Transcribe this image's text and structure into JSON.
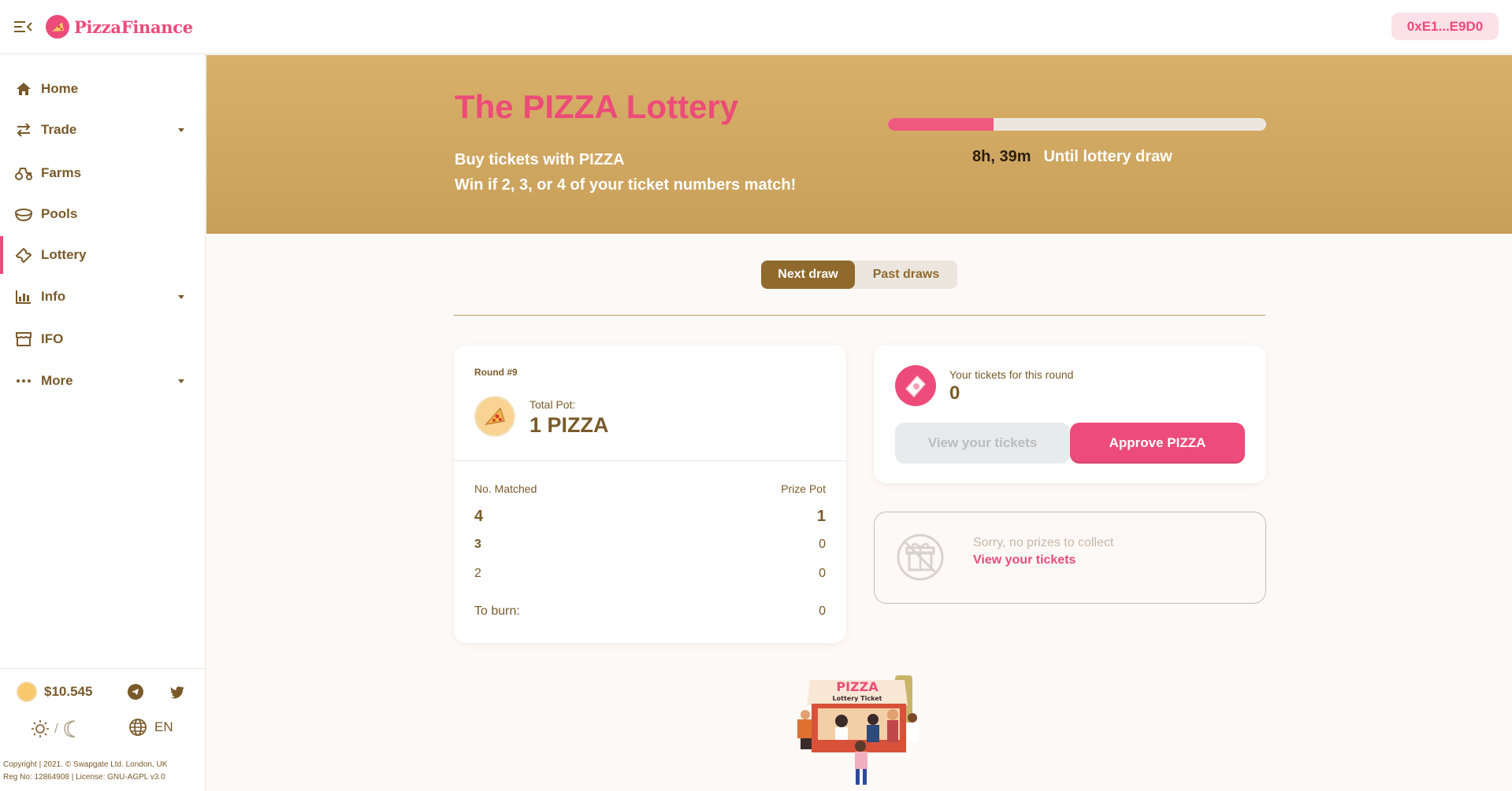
{
  "header": {
    "brand": "PizzaFinance",
    "wallet": "0xE1...E9D0"
  },
  "sidebar": {
    "items": [
      {
        "label": "Home",
        "icon": "home-icon"
      },
      {
        "label": "Trade",
        "icon": "swap-icon",
        "expandable": true
      },
      {
        "label": "Farms",
        "icon": "tractor-icon"
      },
      {
        "label": "Pools",
        "icon": "bowl-icon"
      },
      {
        "label": "Lottery",
        "icon": "ticket-icon",
        "active": true
      },
      {
        "label": "Info",
        "icon": "chart-icon",
        "expandable": true
      },
      {
        "label": "IFO",
        "icon": "store-icon"
      },
      {
        "label": "More",
        "icon": "more-icon",
        "expandable": true
      }
    ],
    "footer": {
      "price": "$10.545",
      "theme_separator": "/",
      "language": "EN",
      "copyright_line1": "Copyright | 2021. © Swapgate Ltd. London, UK",
      "copyright_line2": "Reg No: 12864908 | License: GNU-AGPL v3.0"
    }
  },
  "hero": {
    "title": "The PIZZA Lottery",
    "subtitle1": "Buy tickets with PIZZA",
    "subtitle2": "Win if 2, 3, or 4 of your ticket numbers match!",
    "progress_fraction": 0.28,
    "countdown_time": "8h, 39m",
    "countdown_label": "Until lottery draw"
  },
  "tabs": {
    "next": "Next draw",
    "past": "Past draws",
    "active": "next"
  },
  "pot_card": {
    "round": "Round #9",
    "total_pot_label": "Total Pot:",
    "total_pot_value": "1 PIZZA",
    "col_matched": "No. Matched",
    "col_prize": "Prize Pot",
    "rows": [
      {
        "matched": "4",
        "prize": "1"
      },
      {
        "matched": "3",
        "prize": "0"
      },
      {
        "matched": "2",
        "prize": "0"
      }
    ],
    "burn_label": "To burn:",
    "burn_value": "0"
  },
  "tickets_card": {
    "label": "Your tickets for this round",
    "count": "0",
    "view_button": "View your tickets",
    "approve_button": "Approve PIZZA"
  },
  "prize_card": {
    "message": "Sorry, no prizes to collect",
    "link": "View your tickets"
  },
  "illustration": {
    "sign_title": "PIZZA",
    "sign_subtitle": "Lottery Ticket"
  },
  "colors": {
    "accent": "#ed4b79",
    "brown": "#7a5a2a",
    "hero_gold": "#d9b06a"
  }
}
